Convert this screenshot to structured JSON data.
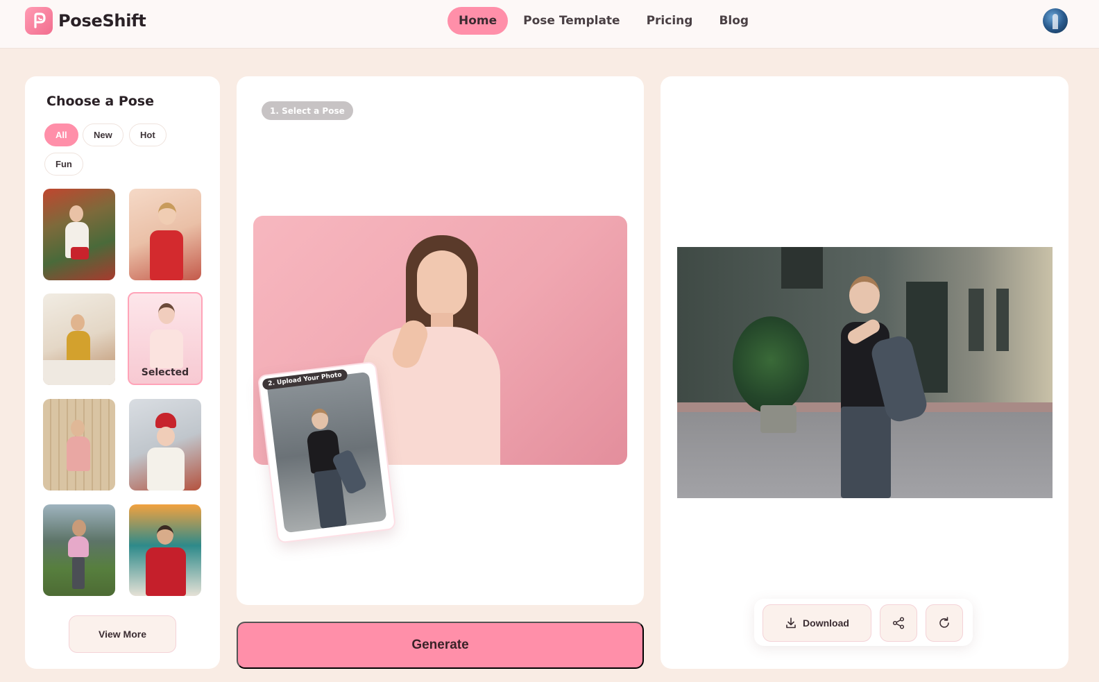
{
  "app": {
    "name": "PoseShift",
    "logo_icon": "poseshift-logo-icon",
    "accent_color": "#ff8fa9"
  },
  "nav": {
    "items": [
      {
        "label": "Home",
        "active": true
      },
      {
        "label": "Pose Template",
        "active": false
      },
      {
        "label": "Pricing",
        "active": false
      },
      {
        "label": "Blog",
        "active": false
      }
    ]
  },
  "user": {
    "avatar_icon": "user-avatar"
  },
  "pose_panel": {
    "title": "Choose a Pose",
    "filters": [
      {
        "label": "All",
        "active": true
      },
      {
        "label": "New",
        "active": false
      },
      {
        "label": "Hot",
        "active": false
      },
      {
        "label": "Fun",
        "active": false
      }
    ],
    "selected_label": "Selected",
    "view_more_label": "View More"
  },
  "workspace": {
    "step1_label": "1. Select a Pose",
    "step2_label": "2. Upload Your Photo",
    "generate_label": "Generate"
  },
  "result": {
    "download_label": "Download",
    "download_icon": "download-icon",
    "share_icon": "share-icon",
    "regenerate_icon": "refresh-icon"
  }
}
